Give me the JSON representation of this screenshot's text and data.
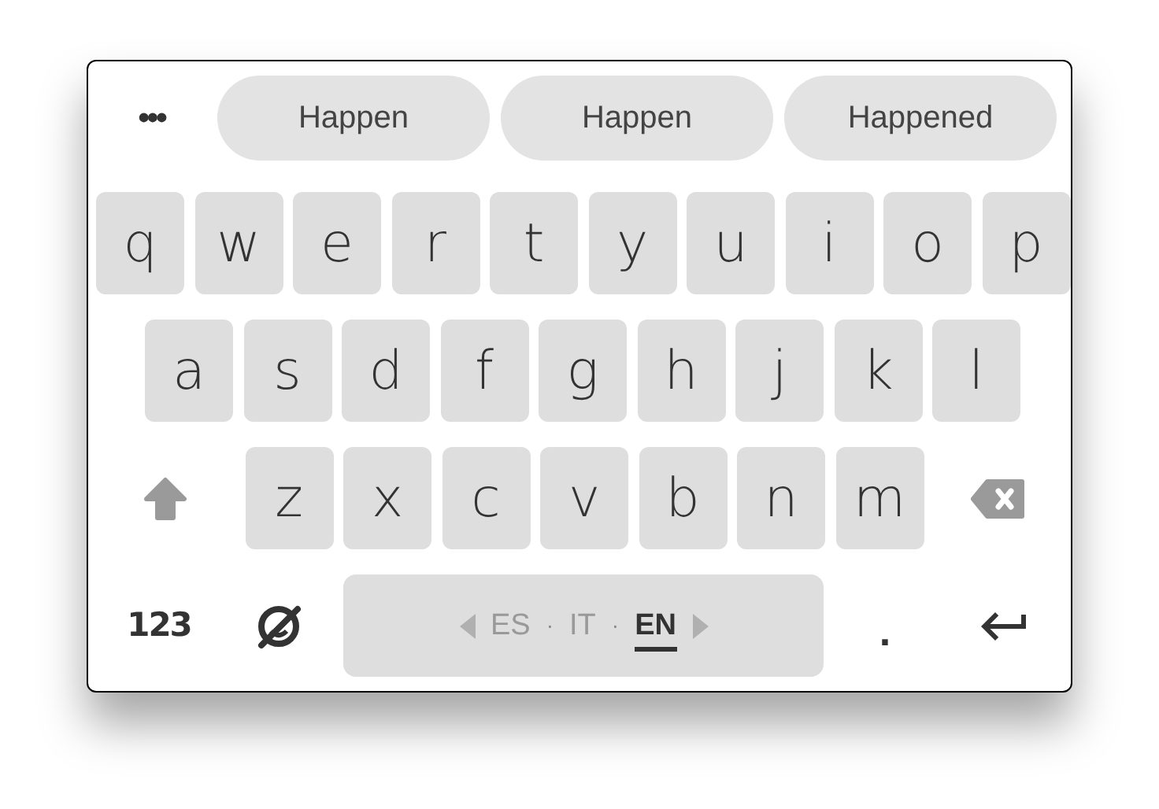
{
  "menu_dots": "•••",
  "suggestions": [
    "Happen",
    "Happen",
    "Happened"
  ],
  "key_rows": [
    [
      "q",
      "w",
      "e",
      "r",
      "t",
      "y",
      "u",
      "i",
      "o",
      "p"
    ],
    [
      "a",
      "s",
      "d",
      "f",
      "g",
      "h",
      "j",
      "k",
      "l"
    ],
    [
      "z",
      "x",
      "c",
      "v",
      "b",
      "n",
      "m"
    ]
  ],
  "bottom_row": {
    "numbers_key": "123",
    "period_key": ".",
    "languages": [
      {
        "label": "ES",
        "selected": false
      },
      {
        "label": "IT",
        "selected": false
      },
      {
        "label": "EN",
        "selected": true
      }
    ],
    "separator": "·"
  }
}
